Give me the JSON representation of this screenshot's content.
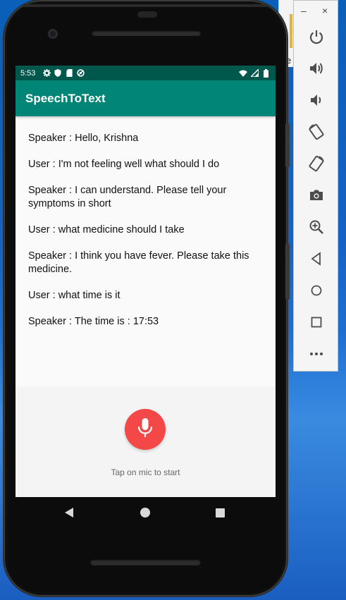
{
  "status_bar": {
    "time": "5:53"
  },
  "app_bar": {
    "title": "SpeechToText"
  },
  "conversation": [
    "Speaker : Hello, Krishna",
    "User : I'm not feeling well what should I do",
    "Speaker : I can understand. Please tell your symptoms in short",
    "User : what medicine should I take",
    "Speaker : I think you have fever. Please take this medicine.",
    "User : what time is it",
    "Speaker : The time is : 17:53"
  ],
  "mic": {
    "hint": "Tap on mic to start",
    "color": "#f44848"
  },
  "emulator_toolbar": {
    "minimize": "–",
    "close": "×",
    "buttons": [
      "power-icon",
      "volume-up-icon",
      "volume-down-icon",
      "rotate-left-icon",
      "rotate-right-icon",
      "camera-icon",
      "zoom-icon",
      "back-icon",
      "home-icon",
      "overview-icon",
      "more-icon"
    ]
  },
  "background_window": {
    "letter": "e"
  },
  "colors": {
    "status_bar": "#00574b",
    "app_bar": "#008577",
    "mic": "#f44848"
  }
}
